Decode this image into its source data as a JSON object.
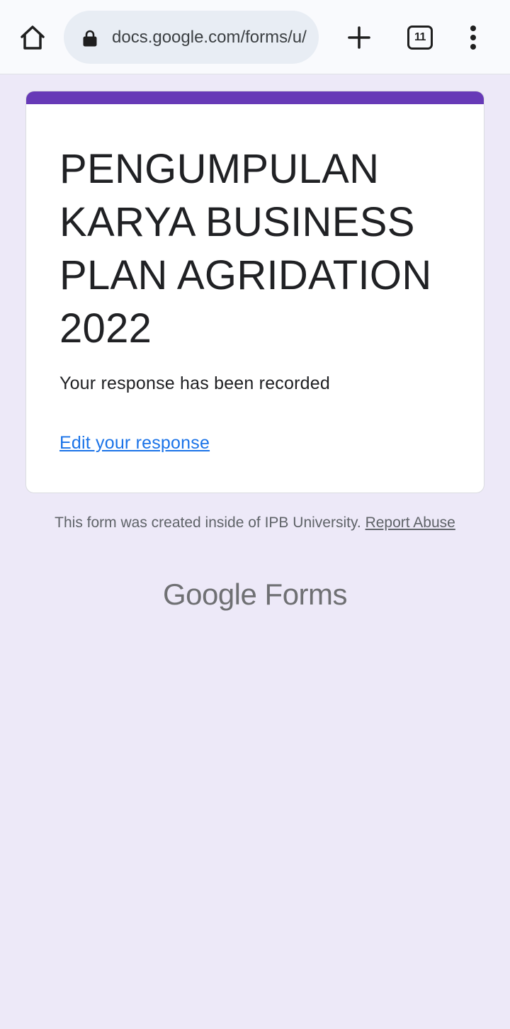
{
  "browser": {
    "url": "docs.google.com/forms/u/",
    "tab_count": "11"
  },
  "form": {
    "accent_color": "#673ab7",
    "title": "PENGUMPULAN KARYA BUSINESS PLAN AGRIDATION 2022",
    "confirmation": "Your response has been recorded",
    "edit_link": "Edit your response"
  },
  "footer": {
    "note": "This form was created inside of IPB University.",
    "report_link": "Report Abuse",
    "brand_google": "Google",
    "brand_forms": "Forms"
  },
  "icons": {
    "home": "home-icon",
    "lock": "lock-icon",
    "add": "plus-icon",
    "tabs": "tabs-icon",
    "menu": "more-vert-icon"
  }
}
